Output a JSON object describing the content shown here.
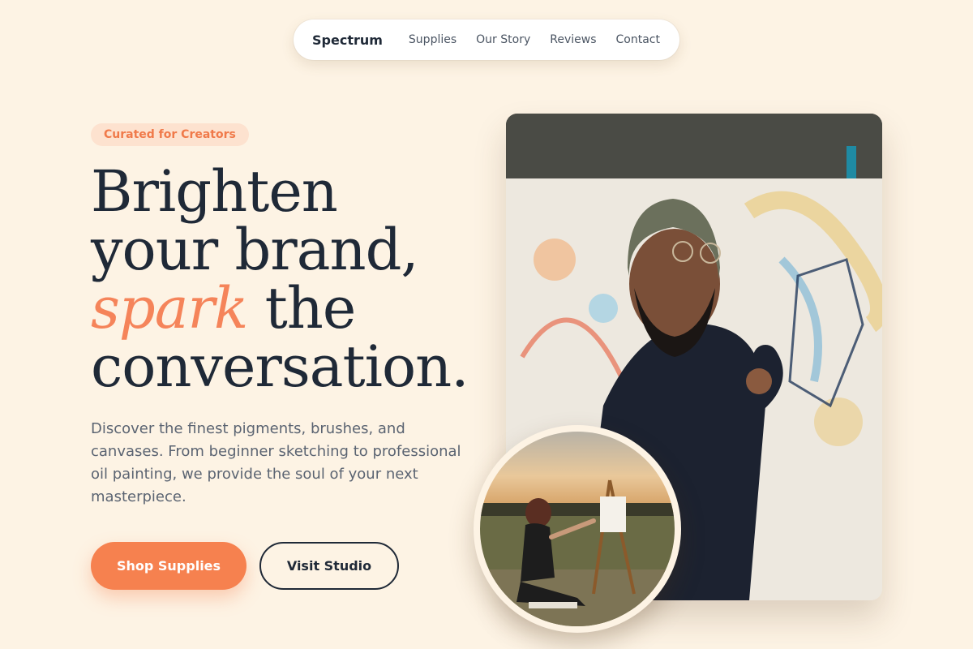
{
  "nav": {
    "brand": "Spectrum",
    "links": [
      "Supplies",
      "Our Story",
      "Reviews",
      "Contact"
    ]
  },
  "hero": {
    "badge": "Curated for Creators",
    "headline_before": "Brighten your brand, ",
    "headline_accent": "spark",
    "headline_after": " the conversation.",
    "lede": "Discover the finest pigments, brushes, and canvases. From beginner sketching to professional oil painting, we provide the soul of your next masterpiece.",
    "primary_cta": "Shop Supplies",
    "secondary_cta": "Visit Studio"
  },
  "images": {
    "main": "photo of bearded artist in beanie painting on a large abstract canvas",
    "inset": "photo of woman painting at an easel outdoors at sunset"
  },
  "colors": {
    "background": "#fdf3e4",
    "accent": "#f6814f",
    "text_dark": "#1f2937",
    "badge_bg": "#fde2cf"
  }
}
